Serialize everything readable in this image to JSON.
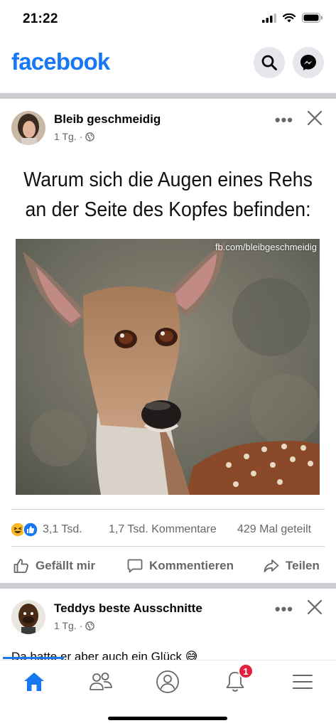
{
  "status_bar": {
    "time": "21:22"
  },
  "header": {
    "logo": "facebook",
    "search_icon": "search-icon",
    "messenger_icon": "messenger-icon",
    "brand_color": "#1877f2"
  },
  "post1": {
    "author": "Bleib geschmeidig",
    "time": "1 Tg.",
    "separator": "·",
    "audience_icon": "globe-icon",
    "more": "•••",
    "title_line1": "Warum sich die Augen eines Rehs",
    "title_line2": "an der Seite des Kopfes befinden:",
    "watermark": "fb.com/bleibgeschmeidig",
    "reactions_count": "3,1 Tsd.",
    "comments_count": "1,7 Tsd. Kommentare",
    "shares_count": "429 Mal geteilt",
    "actions": {
      "like": "Gefällt mir",
      "comment": "Kommentieren",
      "share": "Teilen"
    }
  },
  "post2": {
    "author": "Teddys beste Ausschnitte",
    "time": "1 Tg.",
    "separator": "·",
    "more": "•••",
    "text": "Da hatte er aber auch ein Glück 😅"
  },
  "tab_bar": {
    "tabs": [
      "home-icon",
      "friends-icon",
      "profile-icon",
      "notifications-icon",
      "menu-icon"
    ],
    "notification_badge": "1"
  }
}
